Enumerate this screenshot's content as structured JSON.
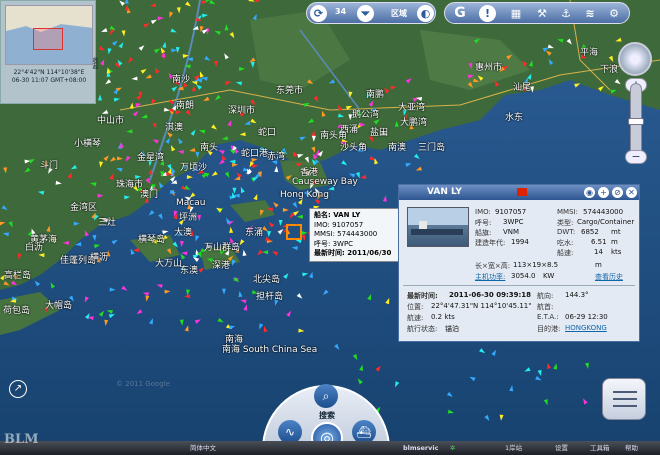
{
  "map": {
    "labels": [
      {
        "text": "珠海市",
        "x": 0,
        "y": 0
      },
      {
        "text": "深圳市",
        "x": 0,
        "y": 0
      }
    ],
    "places": [
      "中山市",
      "深圳市",
      "珠海市",
      "东莞市",
      "惠州市",
      "香港",
      "澳门",
      "南沙",
      "南头",
      "斗门",
      "横琴岛",
      "万山群岛",
      "金星湾",
      "盐田",
      "大鹏湾",
      "大亚湾",
      "南澳",
      "三门岛",
      "蛇口",
      "东涌",
      "担杆岛",
      "北尖岛",
      "南鹏",
      "高栏岛",
      "白沥",
      "大帽岛",
      "荷包岛",
      "三灶",
      "深港",
      "东澳",
      "大万山",
      "佳蓬列岛",
      "黄茅海",
      "赤湾",
      "西涌",
      "横沥",
      "坪洲",
      "大澳",
      "金湾区",
      "水东",
      "平海",
      "下浪",
      "汕尾",
      "南海",
      "淇澳",
      "南朗",
      "小横琴",
      "万顷沙",
      "南头角",
      "沙头角",
      "鹅公湾",
      "蛇口港",
      "Macau",
      "Hong Kong",
      "Causeway Bay",
      "南海 South China Sea"
    ]
  },
  "overview": {
    "coord_line1": "22°4'42\"N 114°10'38\"E",
    "coord_line2": "06-30 11:07 GMT+08:00",
    "toggle_label": "收起"
  },
  "toolbar": {
    "count": "34",
    "sync_icon": "sync-icon",
    "filter_icon": "filter-icon",
    "label_mode": "区域",
    "btn_g": "G",
    "btn_info": "!",
    "btn_calendar": "cal",
    "btn_anchor": "anchor",
    "btn_wave": "wave",
    "btn_settings": "gear"
  },
  "popup": {
    "name_line": "船名: VAN LY",
    "imo_line": "IMO: 9107057",
    "mmsi_line": "MMSI: 574443000",
    "call_line": "呼号: 3WPC",
    "time_line": "最新时间: 2011/06/30"
  },
  "ship_panel": {
    "title": "VAN LY",
    "labels": {
      "imo": "IMO:",
      "mmsi": "MMSI:",
      "callsign": "呼号:",
      "type": "类型:",
      "flag": "船旗:",
      "dwt": "DWT:",
      "built": "建造年代:",
      "draft": "吃水:",
      "length": "长×宽×高:",
      "speed": "船速:",
      "engine": "主机功率:",
      "engine_unit": "KW",
      "history": "查看历史",
      "latest_time": "最新时间:",
      "pos": "位置:",
      "course": "航向:",
      "spd": "航速:",
      "nav_status": "航行状态:",
      "heading": "航首:",
      "eta": "E.T.A.:",
      "dest": "目的港:"
    },
    "values": {
      "imo": "9107057",
      "mmsi": "574443000",
      "callsign": "3WPC",
      "type": "Cargo/Container",
      "flag": "VNM",
      "dwt": "6852",
      "dwt_unit": "mt",
      "built": "1994",
      "draft": "6.51",
      "draft_unit": "m",
      "speed": "14",
      "speed_unit": "kts",
      "length": "113×19×8.5",
      "length_unit": "m",
      "engine": "3054.0",
      "latest_time": "2011-06-30 09:39:18",
      "pos": "22°4'47.31\"N 114°10'45.11\"",
      "course": "144.3°",
      "spd": "0.2 kts",
      "nav_status": "锚泊",
      "heading": "",
      "eta": "06-29 12:30",
      "dest": "HONGKONG"
    }
  },
  "bottom": {
    "lang": "简体中文",
    "brand": "blmservic",
    "item1": "1岸站",
    "item2": "设置",
    "item3": "工具箱",
    "item4": "帮助",
    "search": "搜索",
    "route": "航线",
    "fleet": "船队",
    "logo": "BLM"
  },
  "watermark": "© 2011 Google",
  "colors": {
    "sea": "#1d4f86",
    "land": "#3f6b3a",
    "panel_head": "#2d5590",
    "target": "#ff8a00"
  }
}
